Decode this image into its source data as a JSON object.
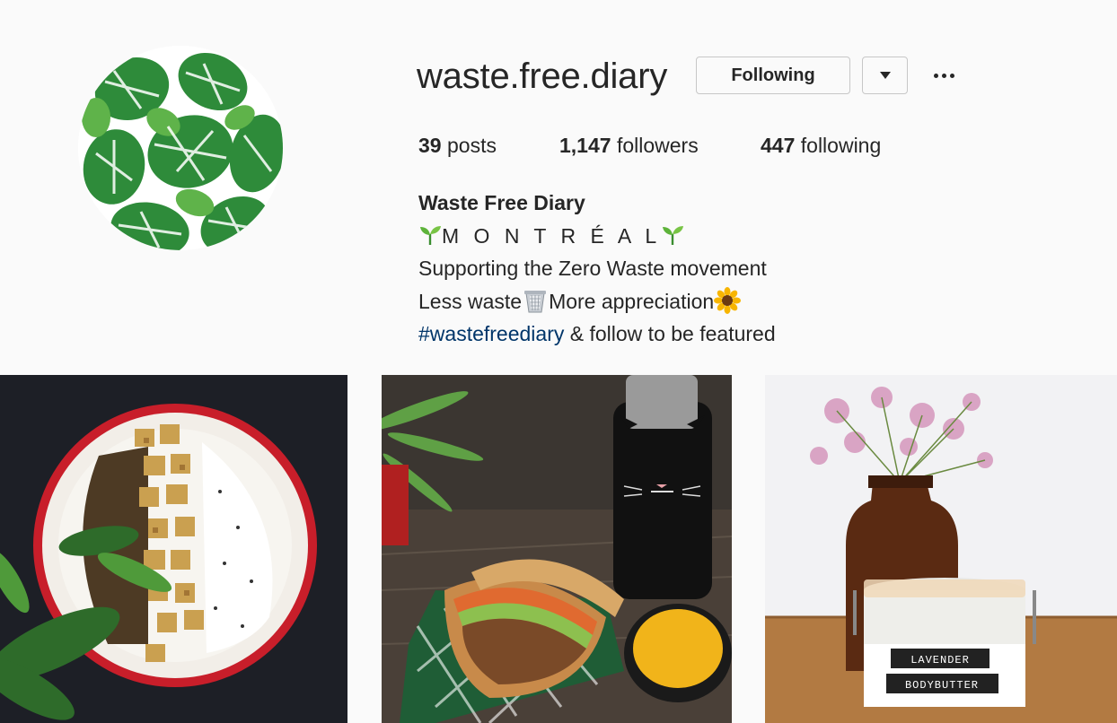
{
  "profile": {
    "username": "waste.free.diary",
    "avatar_icon": "monstera-leaf-pattern",
    "follow_button_label": "Following",
    "dropdown_icon": "caret-down-icon",
    "more_icon": "ellipsis-icon"
  },
  "stats": {
    "posts_count": "39",
    "posts_label": "posts",
    "followers_count": "1,147",
    "followers_label": "followers",
    "following_count": "447",
    "following_label": "following"
  },
  "bio": {
    "full_name": "Waste Free Diary",
    "location": "M O N T R É A L",
    "line1": "Supporting the Zero Waste movement",
    "line2_a": "Less waste",
    "line2_b": "More appreciation",
    "hashtag": "#wastefreediary",
    "line3_rest": " & follow to be featured",
    "link_color": "#003569"
  },
  "posts": [
    {
      "subject": "tofu-lentil-rice-bowl"
    },
    {
      "subject": "sandwich-soup-bottle"
    },
    {
      "subject": "lavender-bodybutter-jar",
      "jar_label_1": "LAVENDER",
      "jar_label_2": "BODYBUTTER"
    }
  ]
}
